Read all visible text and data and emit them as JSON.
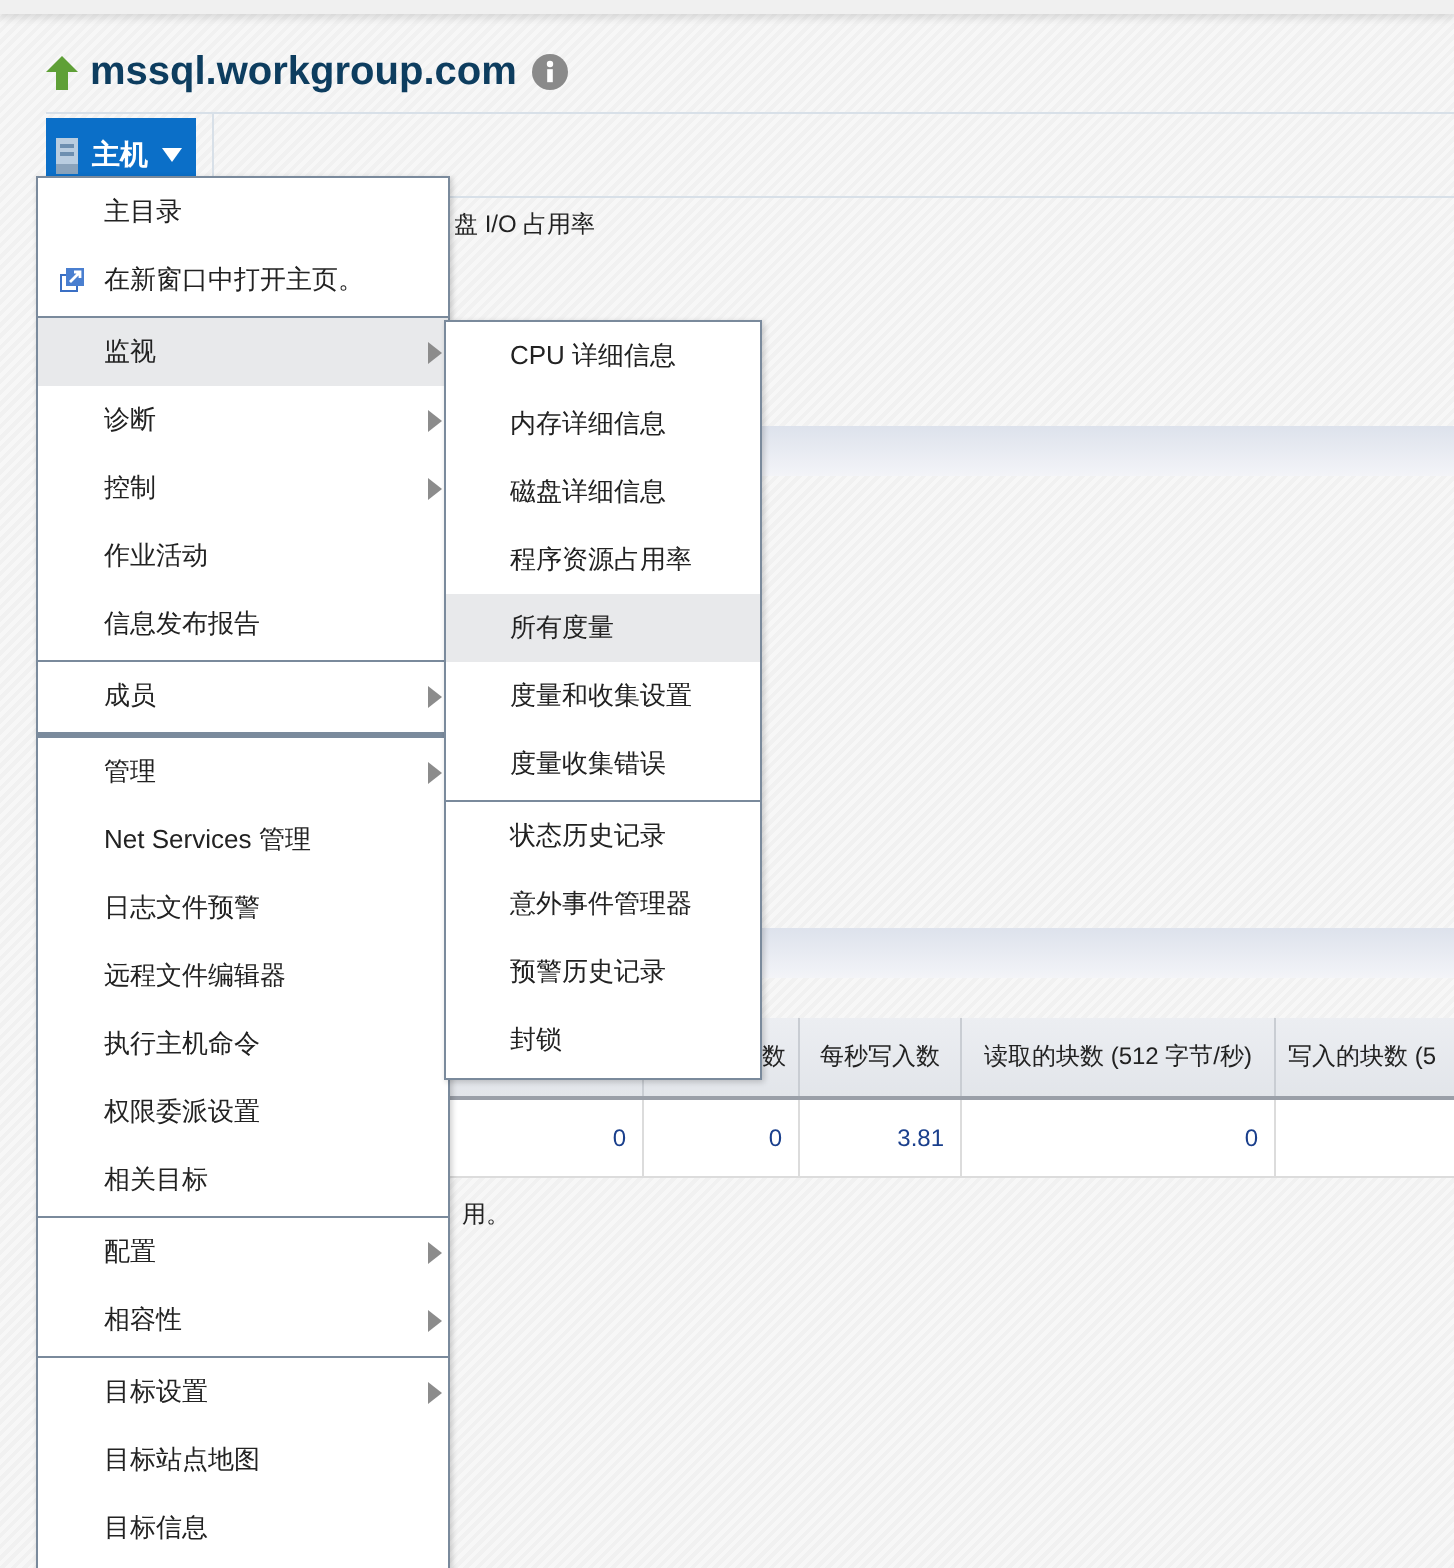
{
  "target": {
    "title": "mssql.workgroup.com"
  },
  "toolbar": {
    "menu_button": {
      "label": "主机",
      "expanded": true
    }
  },
  "page": {
    "section_label": "盘 I/O 占用率",
    "table": {
      "columns": [
        {},
        {
          "label": "数"
        },
        {
          "label": "每秒写入数"
        },
        {
          "label": "读取的块数 (512 字节/秒)"
        },
        {
          "label": "写入的块数 (5"
        }
      ],
      "rows": [
        [
          "0",
          "0",
          "3.81",
          "0"
        ]
      ]
    },
    "note": "用。"
  },
  "menu": {
    "groups": [
      [
        {
          "label": "主目录",
          "kind": "plain",
          "has_submenu": false,
          "selected": false
        },
        {
          "label": "在新窗口中打开主页。",
          "kind": "external",
          "has_submenu": false,
          "selected": false
        }
      ],
      [
        {
          "label": "监视",
          "kind": "plain",
          "has_submenu": true,
          "selected": true
        },
        {
          "label": "诊断",
          "kind": "plain",
          "has_submenu": true,
          "selected": false
        },
        {
          "label": "控制",
          "kind": "plain",
          "has_submenu": true,
          "selected": false
        },
        {
          "label": "作业活动",
          "kind": "plain",
          "has_submenu": false,
          "selected": false
        },
        {
          "label": "信息发布报告",
          "kind": "plain",
          "has_submenu": false,
          "selected": false
        }
      ],
      [
        {
          "label": "成员",
          "kind": "plain",
          "has_submenu": true,
          "selected": false
        }
      ],
      [
        {
          "label": "管理",
          "kind": "plain",
          "has_submenu": true,
          "selected": false
        },
        {
          "label": "Net Services 管理",
          "kind": "plain",
          "has_submenu": false,
          "selected": false
        },
        {
          "label": "日志文件预警",
          "kind": "plain",
          "has_submenu": false,
          "selected": false
        },
        {
          "label": "远程文件编辑器",
          "kind": "plain",
          "has_submenu": false,
          "selected": false
        },
        {
          "label": "执行主机命令",
          "kind": "plain",
          "has_submenu": false,
          "selected": false
        },
        {
          "label": "权限委派设置",
          "kind": "plain",
          "has_submenu": false,
          "selected": false
        },
        {
          "label": "相关目标",
          "kind": "plain",
          "has_submenu": false,
          "selected": false
        }
      ],
      [
        {
          "label": "配置",
          "kind": "plain",
          "has_submenu": true,
          "selected": false
        },
        {
          "label": "相容性",
          "kind": "plain",
          "has_submenu": true,
          "selected": false
        }
      ],
      [
        {
          "label": "目标设置",
          "kind": "plain",
          "has_submenu": true,
          "selected": false
        },
        {
          "label": "目标站点地图",
          "kind": "plain",
          "has_submenu": false,
          "selected": false
        },
        {
          "label": "目标信息",
          "kind": "plain",
          "has_submenu": false,
          "selected": false
        }
      ]
    ]
  },
  "submenu": {
    "groups": [
      [
        {
          "label": "CPU 详细信息",
          "selected": false
        },
        {
          "label": "内存详细信息",
          "selected": false
        },
        {
          "label": "磁盘详细信息",
          "selected": false
        },
        {
          "label": "程序资源占用率",
          "selected": false
        },
        {
          "label": "所有度量",
          "selected": true
        },
        {
          "label": "度量和收集设置",
          "selected": false
        },
        {
          "label": "度量收集错误",
          "selected": false
        }
      ],
      [
        {
          "label": "状态历史记录",
          "selected": false
        },
        {
          "label": "意外事件管理器",
          "selected": false
        },
        {
          "label": "预警历史记录",
          "selected": false
        },
        {
          "label": "封锁",
          "selected": false
        }
      ]
    ]
  }
}
